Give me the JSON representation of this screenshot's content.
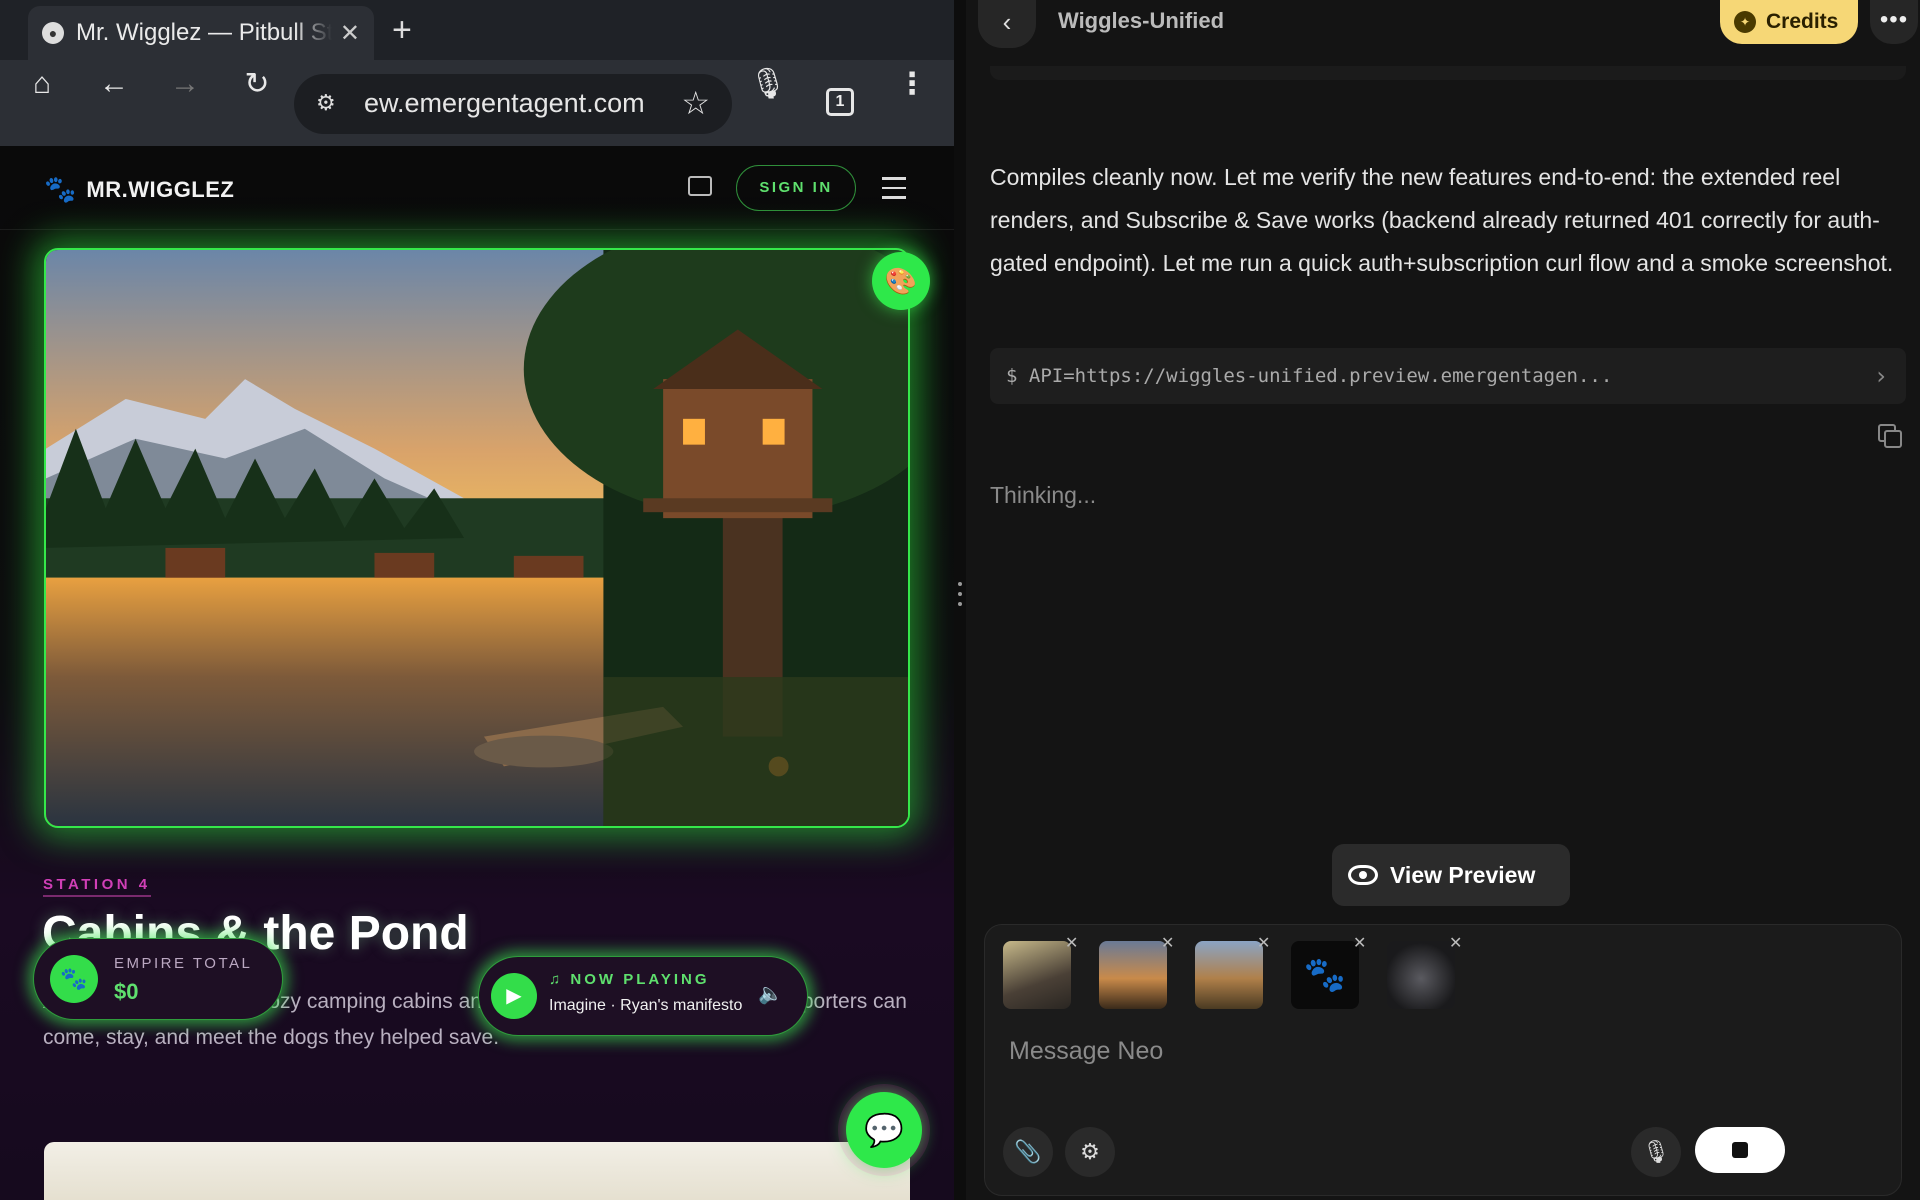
{
  "browser": {
    "tab_title": "Mr. Wigglez — Pitbull Str",
    "url": "ew.emergentagent.com",
    "tab_count": "1"
  },
  "site": {
    "logo_text": "MR.WIGGLEZ",
    "signin_label": "SIGN IN",
    "station_label": "STATION 4",
    "hero_title": "Cabins & the Pond",
    "hero_description": "A quiet pond ringed by cozy camping cabins and a giant treehouse — a place supporters can come, stay, and meet the dogs they helped save.",
    "empire_label": "EMPIRE TOTAL",
    "empire_value": "$0",
    "now_playing_label": "NOW PLAYING",
    "now_playing_track": "Imagine · Ryan's manifesto"
  },
  "agent": {
    "project_name": "Wiggles-Unified",
    "credits_label": "Credits",
    "message": "Compiles cleanly now. Let me verify the new features end-to-end: the extended reel renders, and Subscribe & Save works (backend already returned 401 correctly for auth-gated endpoint). Let me run a quick auth+subscription curl flow and a smoke screenshot.",
    "command": "$ API=https://wiggles-unified.preview.emergentagen...",
    "thinking": "Thinking...",
    "view_preview_label": "View Preview",
    "composer_placeholder": "Message Neo"
  },
  "colors": {
    "accent_green": "#2ee84a",
    "station_magenta": "#d13fb7",
    "credits_gold": "#f6d776"
  }
}
